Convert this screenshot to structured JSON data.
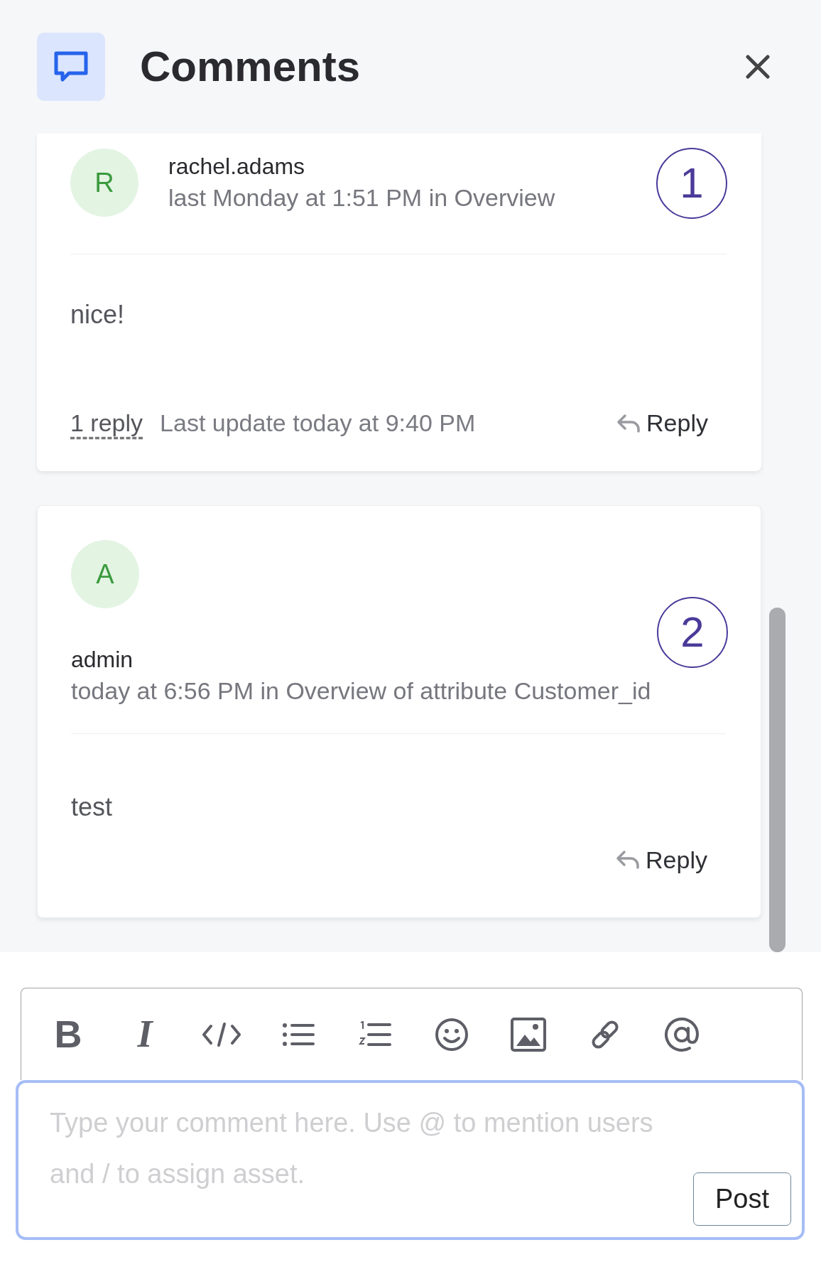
{
  "panel": {
    "title": "Comments"
  },
  "comments": [
    {
      "kind": "inline",
      "avatar": "R",
      "author": "rachel.adams",
      "meta": "last Monday at 1:51 PM in Overview",
      "marker": "1",
      "body": "nice!",
      "replies": "1 reply",
      "last_update": "Last update today at 9:40 PM",
      "reply_label": "Reply"
    },
    {
      "kind": "stacked",
      "avatar": "A",
      "author": "admin",
      "meta": "today at 6:56 PM in Overview of attribute Customer_id",
      "marker": "2",
      "body": "test",
      "reply_label": "Reply"
    }
  ],
  "toolbar": [
    {
      "kind": "bold",
      "glyph": "B"
    },
    {
      "kind": "italic",
      "glyph": "I"
    },
    {
      "kind": "code"
    },
    {
      "kind": "bullets"
    },
    {
      "kind": "numbers"
    },
    {
      "kind": "emoji"
    },
    {
      "kind": "image"
    },
    {
      "kind": "link"
    },
    {
      "kind": "mention"
    }
  ],
  "composer": {
    "placeholder": "Type your comment here. Use @ to mention users and / to assign asset.",
    "button": "Post"
  }
}
